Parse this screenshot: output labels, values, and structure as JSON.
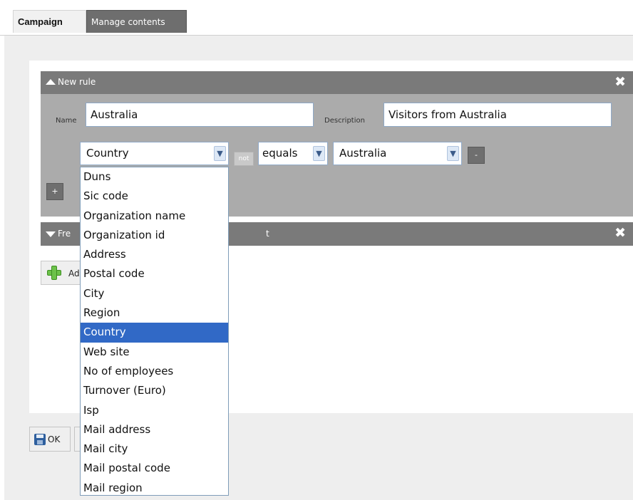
{
  "tabs": [
    {
      "label": "Campaign",
      "active": true
    },
    {
      "label": "Manage contents",
      "active": false
    }
  ],
  "rule_panel": {
    "title": "New rule",
    "name_label": "Name",
    "name_value": "Australia",
    "description_label": "Description",
    "description_value": "Visitors from Australia",
    "field_select": "Country",
    "not_label": "not",
    "operator_select": "equals",
    "value_select": "Australia",
    "remove_label": "-",
    "add_label": "+"
  },
  "second_panel": {
    "title_visible_left": "Fre",
    "title_visible_right": "t"
  },
  "add_button_label": "Ad",
  "ok_label": "OK",
  "dropdown": {
    "selected": "Country",
    "options": [
      "Duns",
      "Sic code",
      "Organization name",
      "Organization id",
      "Address",
      "Postal code",
      "City",
      "Region",
      "Country",
      "Web site",
      "No of employees",
      "Turnover (Euro)",
      "Isp",
      "Mail address",
      "Mail city",
      "Mail postal code",
      "Mail region"
    ]
  },
  "colors": {
    "panel_header": "#7a7a7a",
    "panel_body": "#ababab",
    "selection": "#3169c6"
  }
}
